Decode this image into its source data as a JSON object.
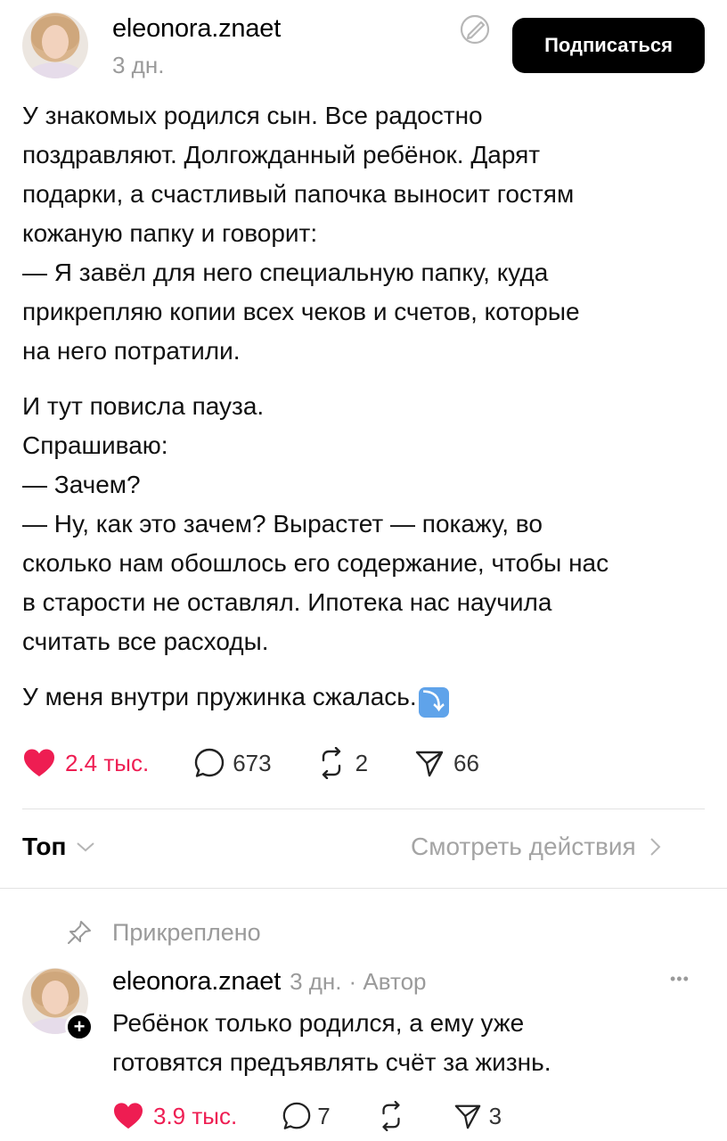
{
  "post": {
    "author": "eleonora.znaet",
    "time": "3 дн.",
    "subscribe_label": "Подписаться",
    "paragraphs": [
      [
        "У знакомых родился сын. Все радостно",
        "поздравляют. Долгожданный ребёнок. Дарят",
        "подарки, а счастливый папочка выносит гостям",
        "кожаную папку и говорит:",
        "— Я завёл для него специальную папку, куда",
        "прикрепляю копии всех чеков и счетов, которые",
        "на него потратили."
      ],
      [
        "И тут повисла  пауза.",
        "Спрашиваю:",
        "— Зачем?",
        "— Ну, как это зачем? Вырастет — покажу, во",
        "сколько нам обошлось его содержание, чтобы нас",
        "в старости не оставлял. Ипотека нас научила",
        "считать все расходы."
      ],
      [
        "У меня внутри пружинка сжалась."
      ]
    ],
    "emoji": "⤵",
    "likes": "2.4 тыс.",
    "comments": "673",
    "reposts": "2",
    "shares": "66"
  },
  "filter": {
    "sort_label": "Топ",
    "activity_label": "Смотреть действия"
  },
  "pinned_comment": {
    "pinned_label": "Прикреплено",
    "author": "eleonora.znaet",
    "time": "3 дн.",
    "role": "· Автор",
    "more": "•••",
    "plus": "+",
    "lines": [
      "Ребёнок только родился, а ему уже",
      "готовятся предъявлять счёт за жизнь."
    ],
    "likes": "3.9 тыс.",
    "comments": "7",
    "shares": "3"
  },
  "colors": {
    "like_red": "#ee1d52",
    "meta_gray": "#9a9a9a",
    "button_black": "#000000"
  }
}
